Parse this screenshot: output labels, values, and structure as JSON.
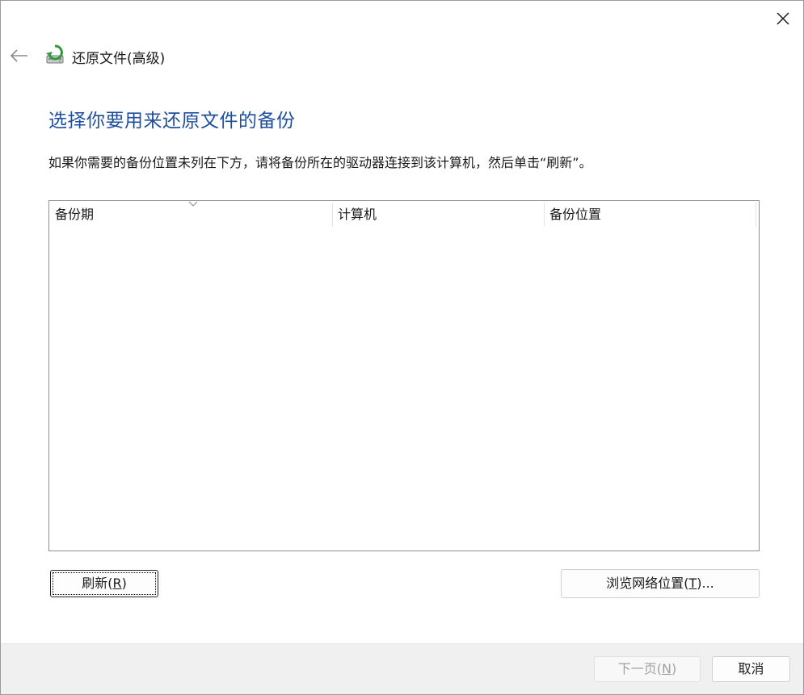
{
  "window": {
    "title": "还原文件(高级)",
    "close_icon": "close-icon",
    "back_icon": "back-arrow-icon",
    "app_icon": "restore-files-icon"
  },
  "main": {
    "heading": "选择你要用来还原文件的备份",
    "instruction": "如果你需要的备份位置未列在下方，请将备份所在的驱动器连接到该计算机，然后单击“刷新”。",
    "table": {
      "columns": [
        "备份期",
        "计算机",
        "备份位置"
      ],
      "sorted_column": "备份期",
      "rows": []
    },
    "refresh_button": {
      "label": "刷新(",
      "accel": "R",
      "suffix": ")"
    },
    "browse_button": {
      "label": "浏览网络位置(",
      "accel": "T",
      "suffix": ")..."
    }
  },
  "footer": {
    "next_button": {
      "label": "下一页(",
      "accel": "N",
      "suffix": ")",
      "enabled": false
    },
    "cancel_button": {
      "label": "取消"
    }
  },
  "colors": {
    "heading": "#1f4e9e",
    "footer_bg": "#f0f0f0"
  }
}
